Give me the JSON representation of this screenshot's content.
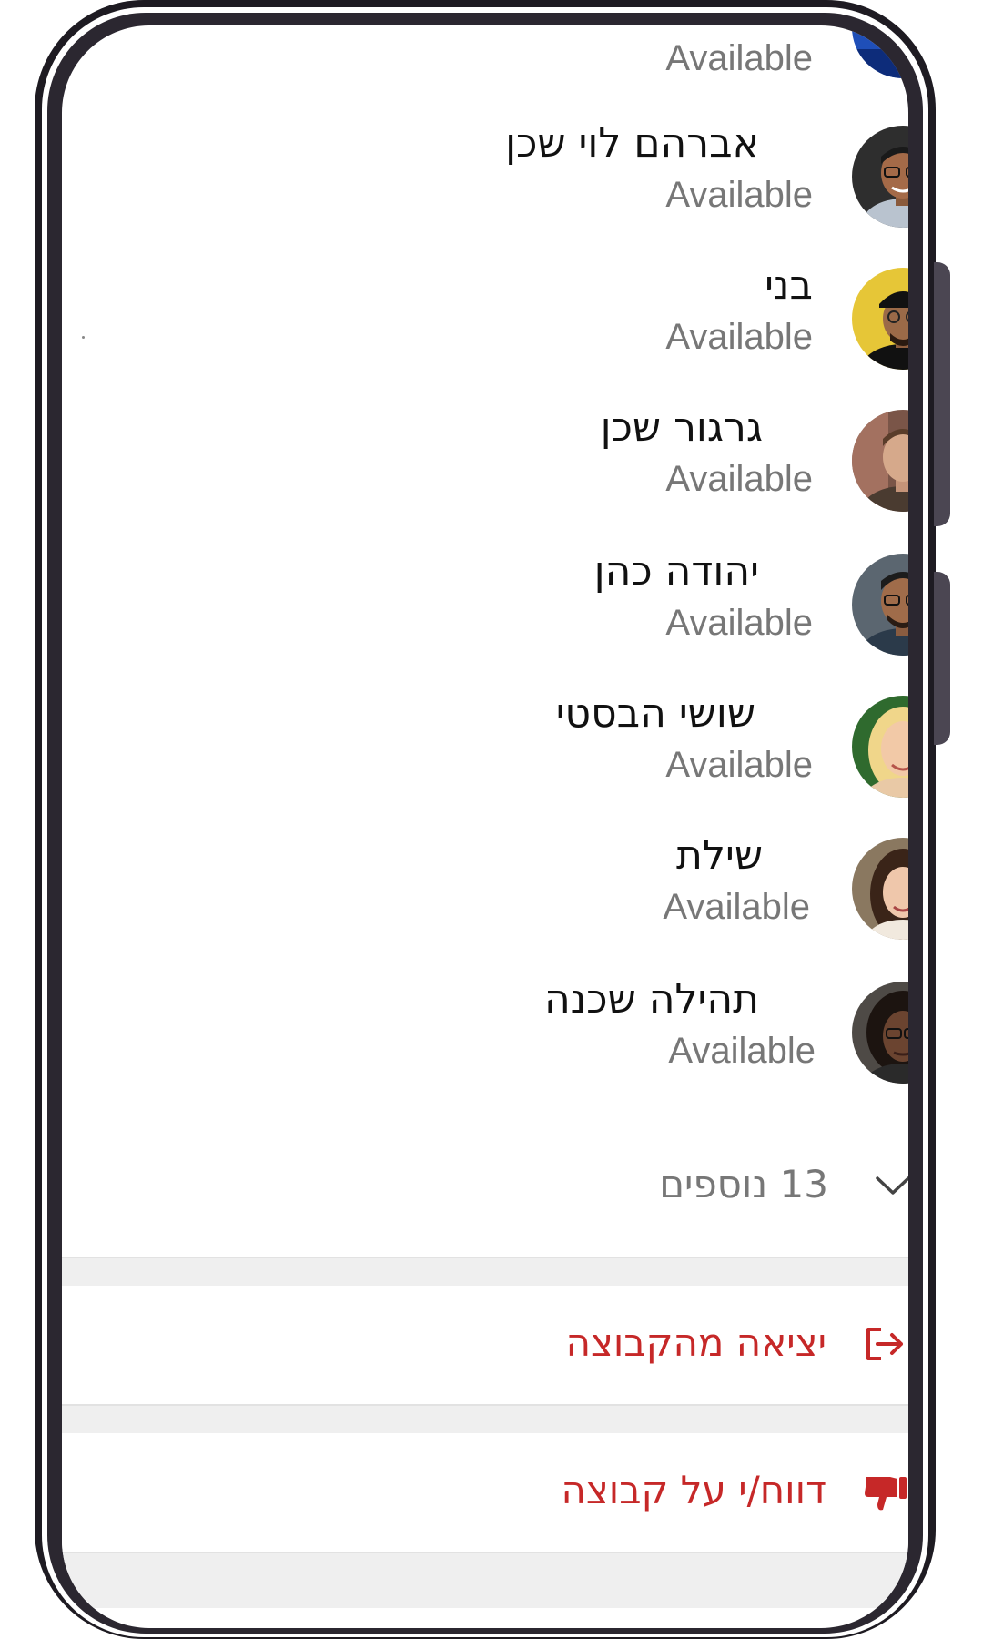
{
  "members": [
    {
      "name": "",
      "status": "Available",
      "avatar": "avatar-colorful-portrait"
    },
    {
      "name": "אברהם לוי שכן",
      "status": "Available",
      "avatar": "avatar-man-glasses-smiling"
    },
    {
      "name": "בני",
      "status": "Available",
      "avatar": "avatar-man-cap-yellow-bg"
    },
    {
      "name": "גרגור שכן",
      "status": "Available",
      "avatar": "avatar-man-short-hair"
    },
    {
      "name": "יהודה כהן",
      "status": "Available",
      "avatar": "avatar-man-glasses-beard"
    },
    {
      "name": "שושי הבסטי",
      "status": "Available",
      "avatar": "avatar-woman-blonde"
    },
    {
      "name": "שילת",
      "status": "Available",
      "avatar": "avatar-woman-brown-hair"
    },
    {
      "name": "תהילה שכנה",
      "status": "Available",
      "avatar": "avatar-woman-glasses-curly"
    }
  ],
  "more": {
    "label": "13 נוספים",
    "icon": "chevron-down-icon"
  },
  "actions": {
    "exit_label": "יציאה מהקבוצה",
    "exit_icon": "exit-icon",
    "report_label": "דווח/י על קבוצה",
    "report_icon": "thumbs-down-icon"
  },
  "colors": {
    "danger": "#c62828",
    "muted": "#777777",
    "section_bg": "#efefef"
  }
}
